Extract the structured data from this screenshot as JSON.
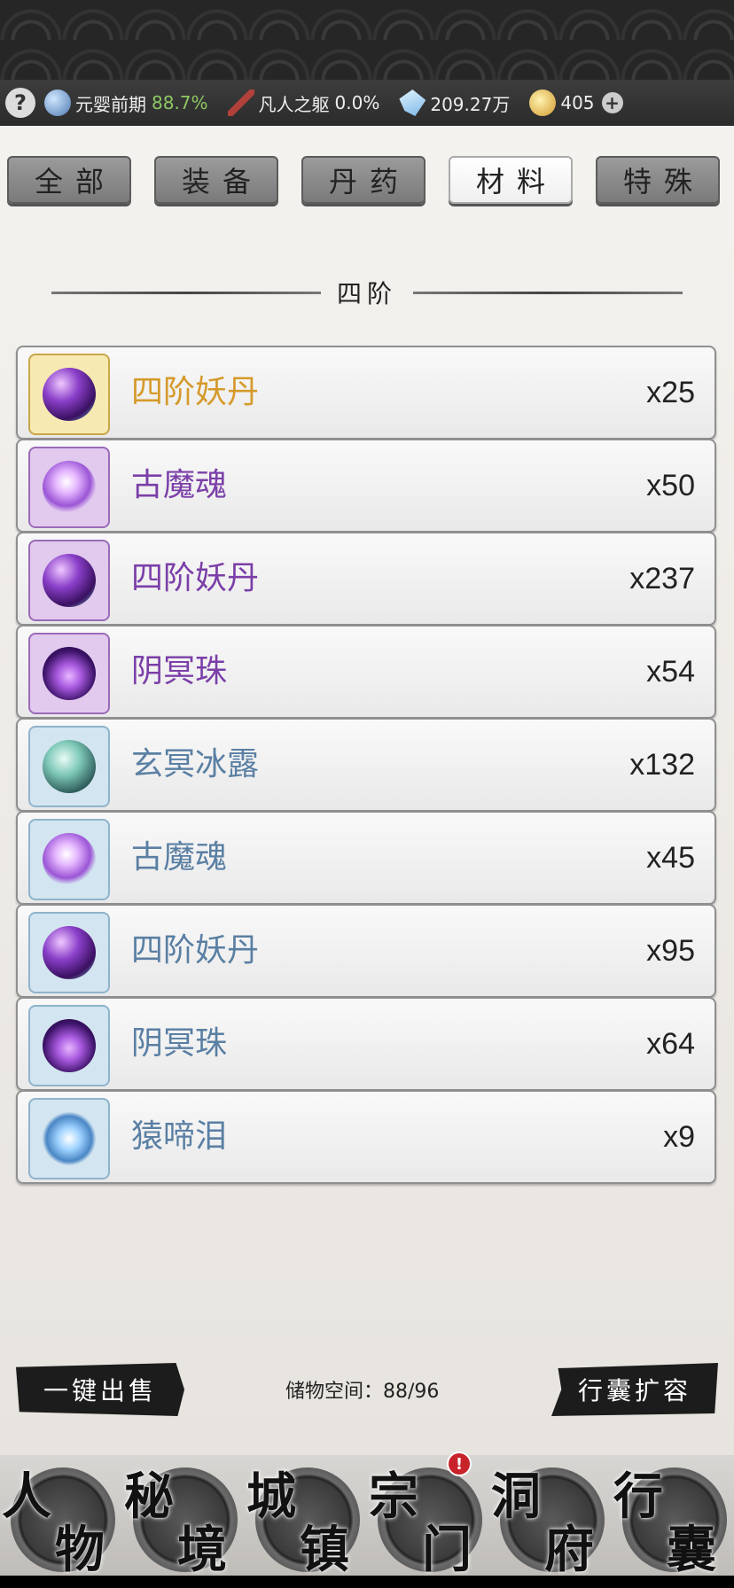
{
  "status": {
    "realm": "元婴前期",
    "realm_progress": "88.7%",
    "body": "凡人之躯",
    "body_progress": "0.0%",
    "spirit_stones": "209.27万",
    "gold": "405"
  },
  "tabs": [
    {
      "label": "全部",
      "active": false
    },
    {
      "label": "装备",
      "active": false
    },
    {
      "label": "丹药",
      "active": false
    },
    {
      "label": "材料",
      "active": true
    },
    {
      "label": "特殊",
      "active": false
    }
  ],
  "section_title": "四阶",
  "items": [
    {
      "name": "四阶妖丹",
      "qty": "x25",
      "rarity": "gold",
      "icon": "demon-core-icon"
    },
    {
      "name": "古魔魂",
      "qty": "x50",
      "rarity": "purple",
      "icon": "demon-soul-icon"
    },
    {
      "name": "四阶妖丹",
      "qty": "x237",
      "rarity": "purple",
      "icon": "demon-core-icon"
    },
    {
      "name": "阴冥珠",
      "qty": "x54",
      "rarity": "purple",
      "icon": "dark-pearl-icon"
    },
    {
      "name": "玄冥冰露",
      "qty": "x132",
      "rarity": "blue",
      "icon": "ice-dew-icon"
    },
    {
      "name": "古魔魂",
      "qty": "x45",
      "rarity": "blue",
      "icon": "demon-soul-icon"
    },
    {
      "name": "四阶妖丹",
      "qty": "x95",
      "rarity": "blue",
      "icon": "demon-core-icon"
    },
    {
      "name": "阴冥珠",
      "qty": "x64",
      "rarity": "blue",
      "icon": "dark-pearl-icon"
    },
    {
      "name": "猿啼泪",
      "qty": "x9",
      "rarity": "blue",
      "icon": "ape-tear-icon"
    }
  ],
  "actions": {
    "sell_all": "一键出售",
    "storage_label": "储物空间：88/96",
    "expand": "行囊扩容"
  },
  "nav": [
    {
      "c1": "人",
      "c2": "物"
    },
    {
      "c1": "秘",
      "c2": "境"
    },
    {
      "c1": "城",
      "c2": "镇"
    },
    {
      "c1": "宗",
      "c2": "门",
      "badge": "!"
    },
    {
      "c1": "洞",
      "c2": "府"
    },
    {
      "c1": "行",
      "c2": "囊"
    }
  ],
  "colors": {
    "gold_text": "#d59a2b",
    "purple_text": "#7b3fa8",
    "blue_text": "#5a7fa3",
    "gold_box_bg": "#f7e9b2",
    "purple_box_bg": "#e2c9ee",
    "blue_box_bg": "#d3e5f0"
  }
}
